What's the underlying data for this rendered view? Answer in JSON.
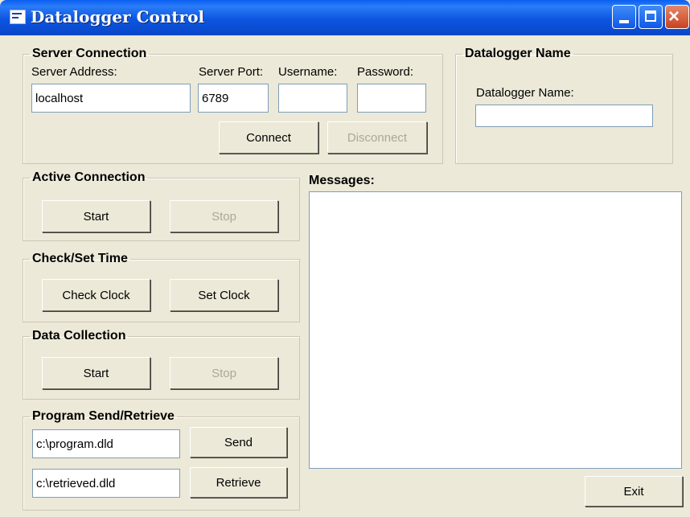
{
  "window": {
    "title": "Datalogger Control"
  },
  "server_connection": {
    "legend": "Server Connection",
    "address_label": "Server Address:",
    "address_value": "localhost",
    "port_label": "Server Port:",
    "port_value": "6789",
    "username_label": "Username:",
    "username_value": "",
    "password_label": "Password:",
    "password_value": "",
    "connect_label": "Connect",
    "disconnect_label": "Disconnect"
  },
  "datalogger": {
    "legend": "Datalogger Name",
    "name_label": "Datalogger Name:",
    "name_value": ""
  },
  "active_connection": {
    "legend": "Active Connection",
    "start_label": "Start",
    "stop_label": "Stop"
  },
  "check_set_time": {
    "legend": "Check/Set Time",
    "check_label": "Check Clock",
    "set_label": "Set Clock"
  },
  "data_collection": {
    "legend": "Data Collection",
    "start_label": "Start",
    "stop_label": "Stop"
  },
  "program": {
    "legend": "Program Send/Retrieve",
    "send_path": "c:\\program.dld",
    "send_label": "Send",
    "retrieve_path": "c:\\retrieved.dld",
    "retrieve_label": "Retrieve"
  },
  "messages": {
    "label": "Messages:",
    "content": ""
  },
  "exit_label": "Exit"
}
